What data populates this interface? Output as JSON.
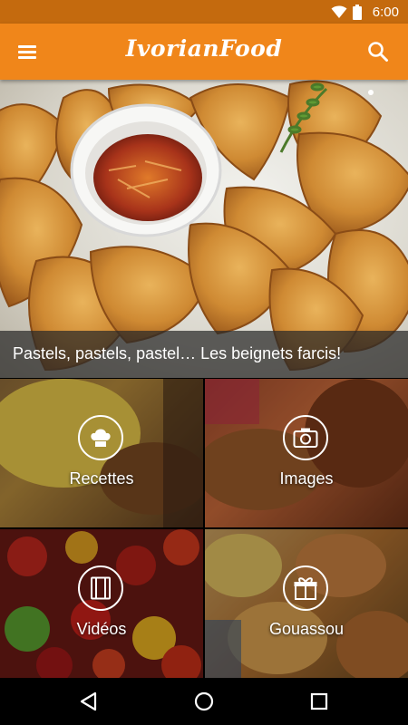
{
  "status_bar": {
    "time": "6:00",
    "icons": [
      "wifi-icon",
      "battery-icon"
    ]
  },
  "app_bar": {
    "title": "IvorianFood",
    "menu_icon": "menu-icon",
    "search_icon": "search-icon"
  },
  "hero": {
    "caption": "Pastels, pastels, pastel… Les beignets farcis!"
  },
  "tiles": [
    {
      "label": "Recettes",
      "icon": "chef-hat-icon"
    },
    {
      "label": "Images",
      "icon": "camera-icon"
    },
    {
      "label": "Vidéos",
      "icon": "film-icon"
    },
    {
      "label": "Gouassou",
      "icon": "gift-icon"
    }
  ],
  "nav_bar": {
    "icons": [
      "back-icon",
      "home-icon",
      "recents-icon"
    ]
  },
  "colors": {
    "app_bar": "#f0861a",
    "status_bar": "#c46a0e",
    "caption_overlay": "#282828"
  }
}
